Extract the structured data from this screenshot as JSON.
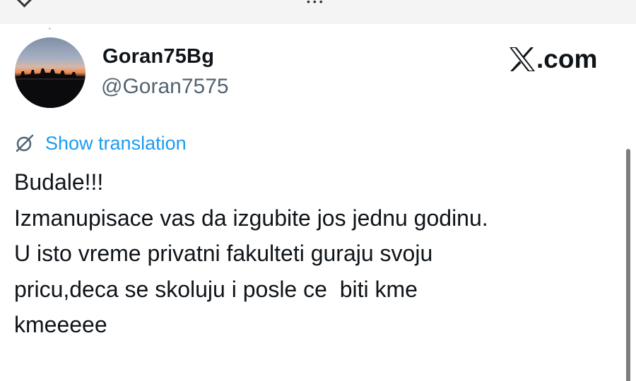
{
  "top_bar": {
    "icons": [
      "chevron-down-icon",
      "more-dots-icon"
    ]
  },
  "tweet": {
    "author": {
      "display_name": "Goran75Bg",
      "handle": "@Goran7575",
      "avatar": "sunset-skyline-avatar"
    },
    "brand": {
      "icon": "x-logo-icon",
      "text": ".com"
    },
    "translation": {
      "icon": "globe-slash-icon",
      "label": "Show translation"
    },
    "lines": [
      "Budale!!!",
      "Izmanupisace vas da izgubite jos jednu godinu.",
      "U isto vreme privatni fakulteti guraju svoju",
      "pricu,deca se skoluju i posle ce  biti kme",
      "kmeeeee"
    ]
  },
  "colors": {
    "text_primary": "#0f1419",
    "text_secondary": "#536471",
    "link": "#1d9bf0",
    "background": "#ffffff",
    "scrollbar": "#7d7d7d"
  }
}
